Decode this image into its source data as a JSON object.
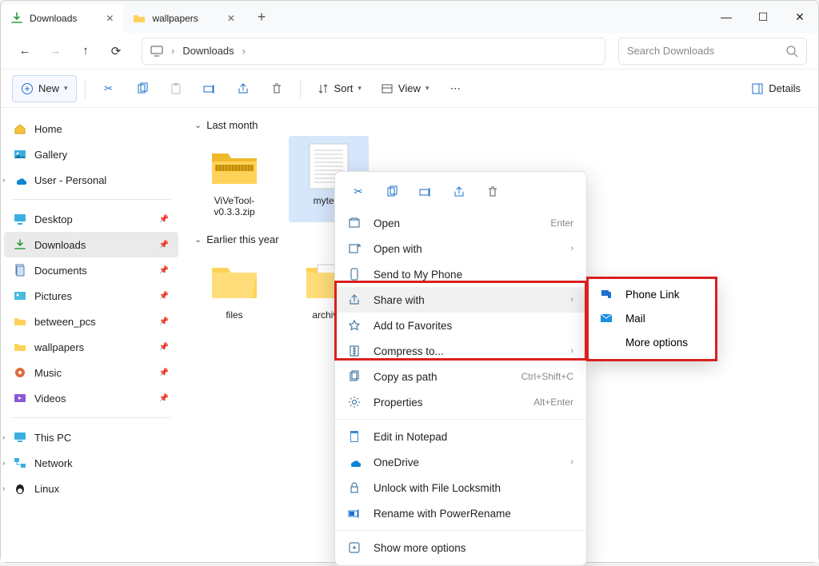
{
  "tabs": [
    {
      "label": "Downloads",
      "active": true,
      "icon": "download"
    },
    {
      "label": "wallpapers",
      "active": false,
      "icon": "folder"
    }
  ],
  "address": {
    "icon_label": "This PC",
    "path": "Downloads"
  },
  "search": {
    "placeholder": "Search Downloads"
  },
  "cmdbar": {
    "new": "New",
    "sort": "Sort",
    "view": "View",
    "details": "Details"
  },
  "sidebar": {
    "top": [
      {
        "label": "Home",
        "icon": "home"
      },
      {
        "label": "Gallery",
        "icon": "gallery"
      },
      {
        "label": "User - Personal",
        "icon": "onedrive",
        "chev": true
      }
    ],
    "pinned": [
      {
        "label": "Desktop",
        "icon": "desktop"
      },
      {
        "label": "Downloads",
        "icon": "download",
        "active": true
      },
      {
        "label": "Documents",
        "icon": "documents"
      },
      {
        "label": "Pictures",
        "icon": "pictures"
      },
      {
        "label": "between_pcs",
        "icon": "folder"
      },
      {
        "label": "wallpapers",
        "icon": "folder"
      },
      {
        "label": "Music",
        "icon": "music"
      },
      {
        "label": "Videos",
        "icon": "videos"
      }
    ],
    "bottom": [
      {
        "label": "This PC",
        "icon": "thispc",
        "chev": true
      },
      {
        "label": "Network",
        "icon": "network",
        "chev": true
      },
      {
        "label": "Linux",
        "icon": "linux",
        "chev": true
      }
    ]
  },
  "groups": [
    {
      "header": "Last month",
      "files": [
        {
          "name": "ViVeTool-v0.3.3.zip",
          "type": "zip"
        },
        {
          "name": "mytext.",
          "type": "text",
          "selected": true
        }
      ]
    },
    {
      "header": "Earlier this year",
      "files": [
        {
          "name": "files",
          "type": "folder"
        },
        {
          "name": "archival",
          "type": "folder-doc"
        }
      ]
    }
  ],
  "context_menu": {
    "items": [
      {
        "label": "Open",
        "icon": "open",
        "shortcut": "Enter"
      },
      {
        "label": "Open with",
        "icon": "openwith",
        "submenu": true
      },
      {
        "label": "Send to My Phone",
        "icon": "phone"
      },
      {
        "label": "Share with",
        "icon": "share",
        "submenu": true,
        "hover": true
      },
      {
        "label": "Add to Favorites",
        "icon": "star"
      },
      {
        "label": "Compress to...",
        "icon": "compress",
        "submenu": true
      },
      {
        "label": "Copy as path",
        "icon": "copypath",
        "shortcut": "Ctrl+Shift+C"
      },
      {
        "label": "Properties",
        "icon": "properties",
        "shortcut": "Alt+Enter"
      },
      {
        "div": true
      },
      {
        "label": "Edit in Notepad",
        "icon": "notepad"
      },
      {
        "label": "OneDrive",
        "icon": "onedrive",
        "submenu": true
      },
      {
        "label": "Unlock with File Locksmith",
        "icon": "lock"
      },
      {
        "label": "Rename with PowerRename",
        "icon": "rename"
      },
      {
        "div": true
      },
      {
        "label": "Show more options",
        "icon": "more"
      }
    ]
  },
  "submenu": {
    "items": [
      {
        "label": "Phone Link",
        "icon": "phonelink"
      },
      {
        "label": "Mail",
        "icon": "mail"
      },
      {
        "label": "More options",
        "icon": ""
      }
    ]
  }
}
